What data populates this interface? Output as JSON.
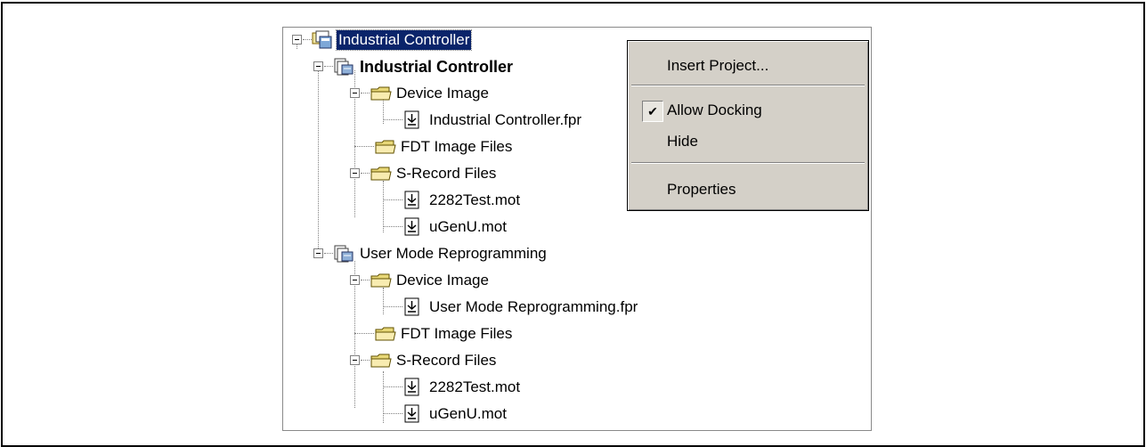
{
  "tree": {
    "root": {
      "label": "Industrial Controller"
    },
    "project1": {
      "label": "Industrial Controller",
      "device_image": {
        "label": "Device Image",
        "file": "Industrial Controller.fpr"
      },
      "fdt_image_files": {
        "label": "FDT Image Files"
      },
      "srecord_files": {
        "label": "S-Record Files",
        "files": [
          "2282Test.mot",
          "uGenU.mot"
        ]
      }
    },
    "project2": {
      "label": "User Mode Reprogramming",
      "device_image": {
        "label": "Device Image",
        "file": "User Mode Reprogramming.fpr"
      },
      "fdt_image_files": {
        "label": "FDT Image Files"
      },
      "srecord_files": {
        "label": "S-Record Files",
        "files": [
          "2282Test.mot",
          "uGenU.mot"
        ]
      }
    }
  },
  "context_menu": {
    "items": [
      {
        "label": "Insert Project..."
      },
      {
        "label": "Allow Docking",
        "checked": true
      },
      {
        "label": "Hide"
      },
      {
        "label": "Properties"
      }
    ]
  },
  "colors": {
    "selection": "#0a246a",
    "menu_bg": "#d4d0c8",
    "folder": "#e8d878"
  },
  "icons": [
    "workspace-icon",
    "project-icon",
    "folder-icon",
    "file-download-icon",
    "checkmark-icon"
  ]
}
